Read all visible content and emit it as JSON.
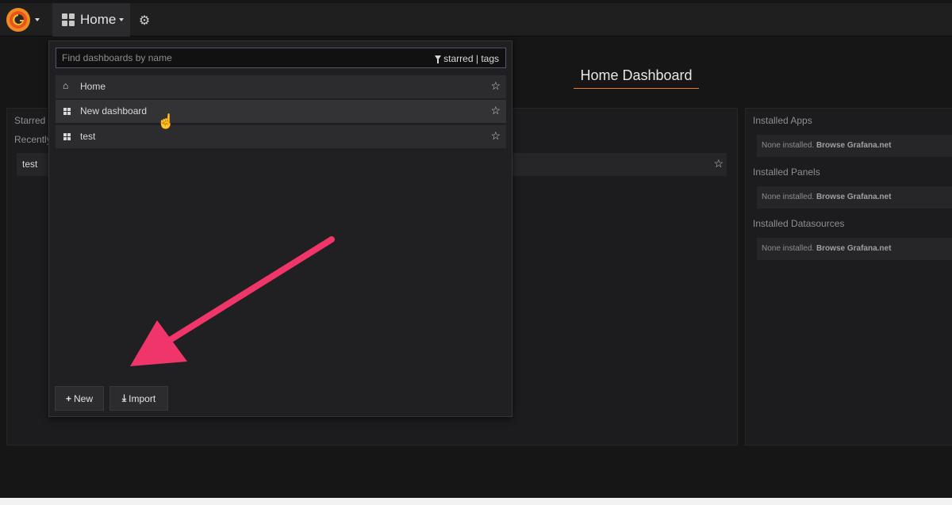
{
  "navbar": {
    "home_label": "Home",
    "logo_icon": "grafana-logo-icon",
    "settings_icon": "gear-icon"
  },
  "dashboard": {
    "title": "Home Dashboard",
    "left_panel": {
      "starred_label": "Starred",
      "recent_label": "Recently",
      "recent_item": "test"
    },
    "right_panel": {
      "sections": [
        {
          "heading": "Installed Apps",
          "none_text": "None installed.",
          "link_text": "Browse Grafana.net"
        },
        {
          "heading": "Installed Panels",
          "none_text": "None installed.",
          "link_text": "Browse Grafana.net"
        },
        {
          "heading": "Installed Datasources",
          "none_text": "None installed.",
          "link_text": "Browse Grafana.net"
        }
      ]
    }
  },
  "search": {
    "placeholder": "Find dashboards by name",
    "filter_starred": "starred",
    "filter_separator": " | ",
    "filter_tags": "tags"
  },
  "dashboards": [
    {
      "label": "Home",
      "icon": "home-icon"
    },
    {
      "label": "New dashboard",
      "icon": "dashboard-grid-icon"
    },
    {
      "label": "test",
      "icon": "dashboard-grid-icon"
    }
  ],
  "actions": {
    "new_label": "New",
    "import_label": "Import"
  },
  "colors": {
    "accent": "#eb7b18",
    "annotation_arrow": "#f0356b"
  }
}
